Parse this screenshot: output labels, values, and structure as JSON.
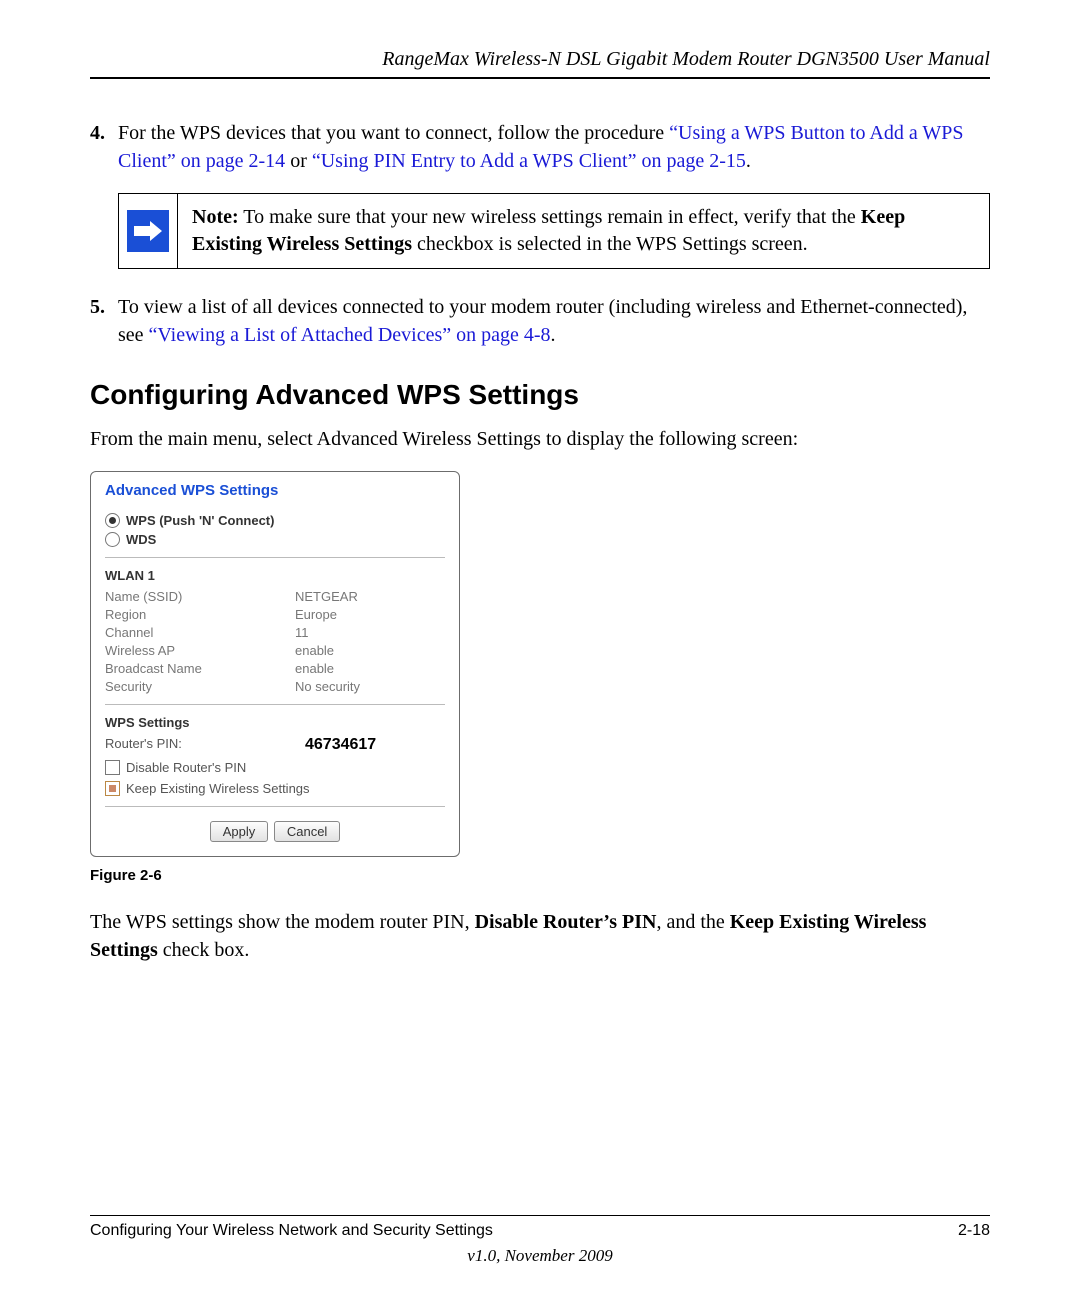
{
  "header_title": "RangeMax Wireless-N DSL Gigabit Modem Router DGN3500 User Manual",
  "step4": {
    "num": "4.",
    "t1": "For the WPS devices that you want to connect, follow the procedure ",
    "link1": "“Using a WPS Button to Add a WPS Client” on page 2-14",
    "t2": " or ",
    "link2": "“Using PIN Entry to Add a WPS Client” on page 2-15",
    "t3": "."
  },
  "note": {
    "label": "Note:",
    "t1": " To make sure that your new wireless settings remain in effect, verify that the ",
    "bold": "Keep Existing Wireless Settings",
    "t2": " checkbox is selected in the WPS Settings screen."
  },
  "step5": {
    "num": "5.",
    "t1": "To view a list of all devices connected to your modem router (including wireless and Ethernet-connected), see ",
    "link": "“Viewing a List of Attached Devices” on page 4-8",
    "t2": "."
  },
  "h2": "Configuring Advanced WPS Settings",
  "intro": "From the main menu, select Advanced Wireless Settings to display the following screen:",
  "panel": {
    "title": "Advanced WPS Settings",
    "radio1": "WPS (Push 'N' Connect)",
    "radio2": "WDS",
    "wlan_head": "WLAN 1",
    "rows": [
      {
        "k": "Name (SSID)",
        "v": "NETGEAR"
      },
      {
        "k": "Region",
        "v": "Europe"
      },
      {
        "k": "Channel",
        "v": "11"
      },
      {
        "k": "Wireless AP",
        "v": "enable"
      },
      {
        "k": "Broadcast Name",
        "v": "enable"
      },
      {
        "k": "Security",
        "v": "No security"
      }
    ],
    "wps_head": "WPS Settings",
    "pin_label": "Router's PIN:",
    "pin_value": "46734617",
    "chk1": "Disable Router's PIN",
    "chk2": "Keep Existing Wireless Settings",
    "btn_apply": "Apply",
    "btn_cancel": "Cancel"
  },
  "fig_caption": "Figure 2-6",
  "closing": {
    "t1": "The WPS settings show the modem router PIN, ",
    "b1": "Disable Router’s PIN",
    "t2": ", and the ",
    "b2": "Keep Existing Wireless Settings",
    "t3": " check box."
  },
  "footer": {
    "left": "Configuring Your Wireless Network and Security Settings",
    "right": "2-18",
    "version": "v1.0, November 2009"
  }
}
